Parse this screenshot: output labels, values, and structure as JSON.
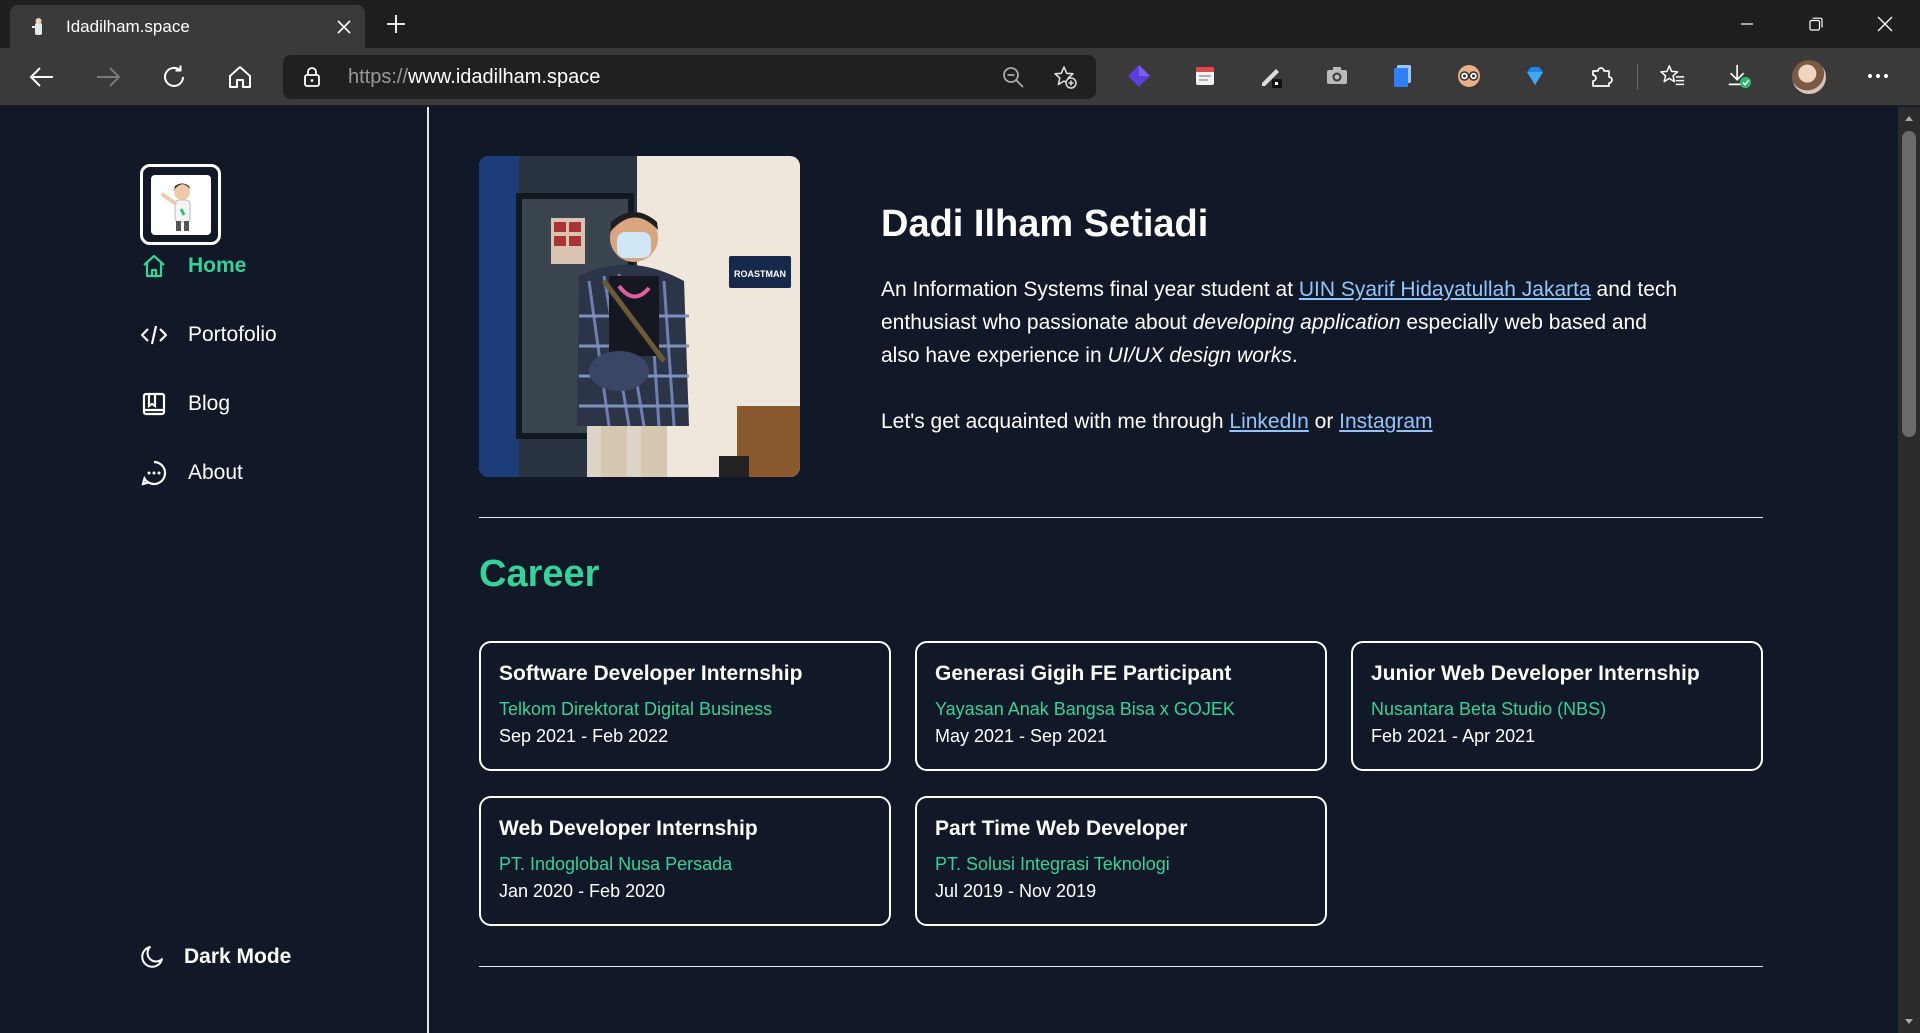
{
  "browser": {
    "tab_title": "Idadilham.space",
    "url_scheme": "https://",
    "url_host": "www.idadilham.space"
  },
  "sidebar": {
    "nav": [
      {
        "label": "Home",
        "icon": "home-icon",
        "active": true
      },
      {
        "label": "Portofolio",
        "icon": "code-icon",
        "active": false
      },
      {
        "label": "Blog",
        "icon": "book-icon",
        "active": false
      },
      {
        "label": "About",
        "icon": "chat-icon",
        "active": false
      }
    ],
    "dark_mode_label": "Dark Mode"
  },
  "hero": {
    "name": "Dadi Ilham Setiadi",
    "desc_1": "An Information Systems final year student at ",
    "university": "UIN Syarif Hidayatullah Jakarta",
    "desc_2": "and tech enthusiast who passionate about ",
    "desc_em_1": "developing application",
    "desc_3": " especially web based and also have experience in ",
    "desc_em_2": "UI/UX design works",
    "desc_4": ".",
    "cta_text": "Let's get acquainted with me through ",
    "link_linkedin": "LinkedIn",
    "cta_or": " or ",
    "link_instagram": "Instagram",
    "photo_sign": "ROASTMAN"
  },
  "career": {
    "title": "Career",
    "items": [
      {
        "role": "Software Developer Internship",
        "org": "Telkom Direktorat Digital Business",
        "period": "Sep 2021 - Feb 2022"
      },
      {
        "role": "Generasi Gigih FE Participant",
        "org": "Yayasan Anak Bangsa Bisa x GOJEK",
        "period": "May 2021 - Sep 2021"
      },
      {
        "role": "Junior Web Developer Internship",
        "org": "Nusantara Beta Studio (NBS)",
        "period": "Feb 2021 - Apr 2021"
      },
      {
        "role": "Web Developer Internship",
        "org": "PT. Indoglobal Nusa Persada",
        "period": "Jan 2020 - Feb 2020"
      },
      {
        "role": "Part Time Web Developer",
        "org": "PT. Solusi Integrasi Teknologi",
        "period": "Jul 2019 - Nov 2019"
      }
    ]
  },
  "colors": {
    "background": "#111827",
    "accent": "#34d399",
    "link": "#93c5fd"
  }
}
